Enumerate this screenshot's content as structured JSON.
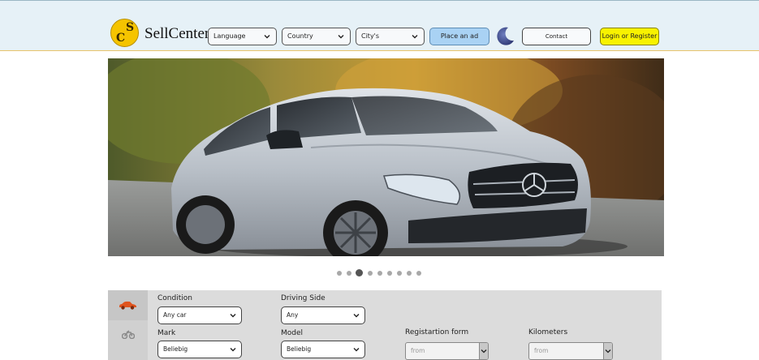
{
  "header": {
    "brand": "SellCenter",
    "logo_letters": [
      "S",
      "C"
    ],
    "selects": [
      {
        "label": "Language"
      },
      {
        "label": "Country"
      },
      {
        "label": "City's"
      }
    ],
    "place_ad_label": "Place an ad",
    "contact_label": "Contact",
    "login_label": "Login or Register",
    "theme_icon": "moon-icon"
  },
  "carousel": {
    "slide_count": 9,
    "active_index": 2
  },
  "search": {
    "vehicle_tabs": [
      {
        "icon": "car-icon",
        "active": true
      },
      {
        "icon": "motorcycle-icon",
        "active": false
      }
    ],
    "condition": {
      "label": "Condition",
      "value": "Any car"
    },
    "driving_side": {
      "label": "Driving Side",
      "value": "Any"
    },
    "mark": {
      "label": "Mark",
      "value": "Beliebig"
    },
    "model": {
      "label": "Model",
      "value": "Beliebig"
    },
    "registration": {
      "label": "Registartion form",
      "placeholder": "from"
    },
    "kilometers": {
      "label": "Kilometers",
      "placeholder": "from"
    }
  },
  "colors": {
    "header_bg": "#e6f1f7",
    "place_ad_bg": "#a9d2f4",
    "login_bg": "#f8f200",
    "panel_bg": "#dcdcdc",
    "car_icon": "#e0541e"
  }
}
